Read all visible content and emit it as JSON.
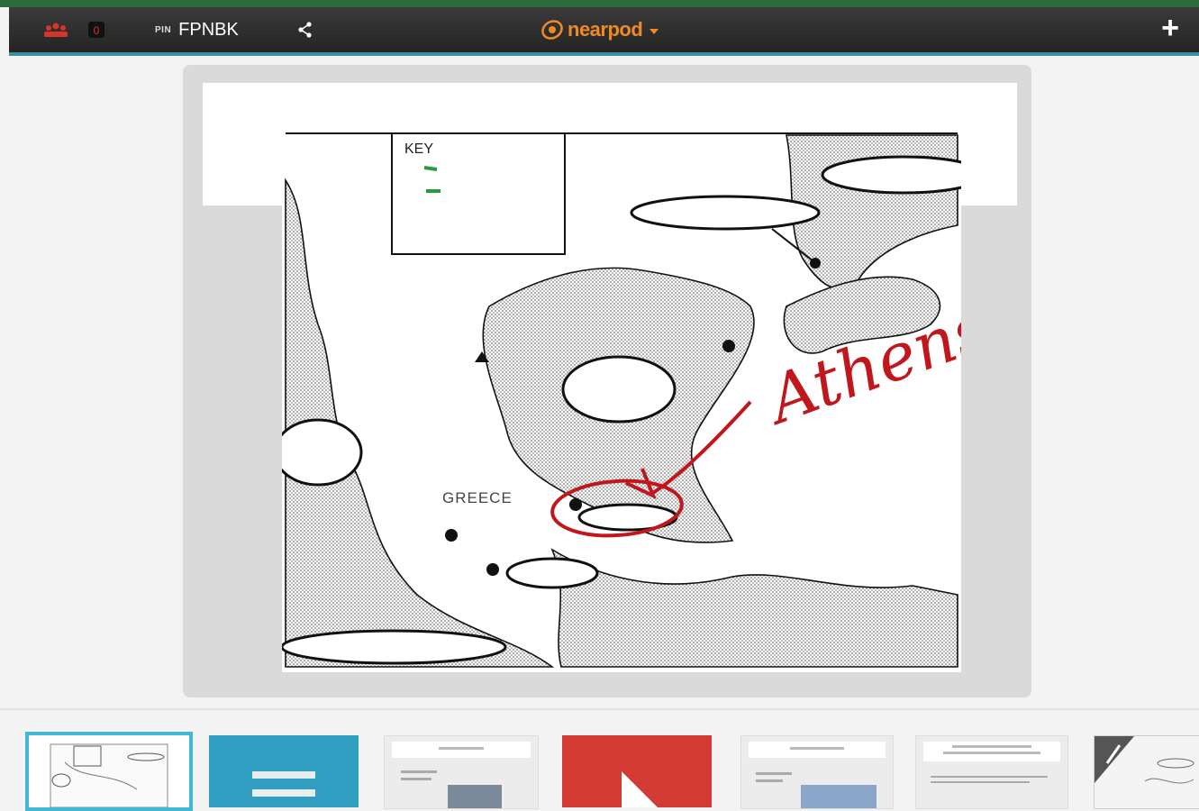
{
  "topbar": {
    "students_count": "0",
    "pin_label": "PIN",
    "pin_code": "FPNBK",
    "logo_text": "nearpod",
    "add_label": "+"
  },
  "slide": {
    "map": {
      "key_label": "KEY",
      "country_label": "GREECE",
      "annotation": "Athens"
    }
  },
  "colors": {
    "topbar": "#2a2a2a",
    "accent_teal": "#3a8fa0",
    "logo_orange": "#f08a24",
    "annotation_red": "#c0161c",
    "thumb_selected": "#42b8d4",
    "thumb_blue": "#2f9ec0",
    "thumb_red": "#d33a34"
  },
  "thumbnails": [
    {
      "kind": "map-slide",
      "selected": true
    },
    {
      "kind": "text-activity",
      "icon": "lines-icon"
    },
    {
      "kind": "slide"
    },
    {
      "kind": "video",
      "icon": "play-icon"
    },
    {
      "kind": "slide"
    },
    {
      "kind": "slide"
    },
    {
      "kind": "drawing-slide",
      "icon": "pencil-icon"
    }
  ]
}
